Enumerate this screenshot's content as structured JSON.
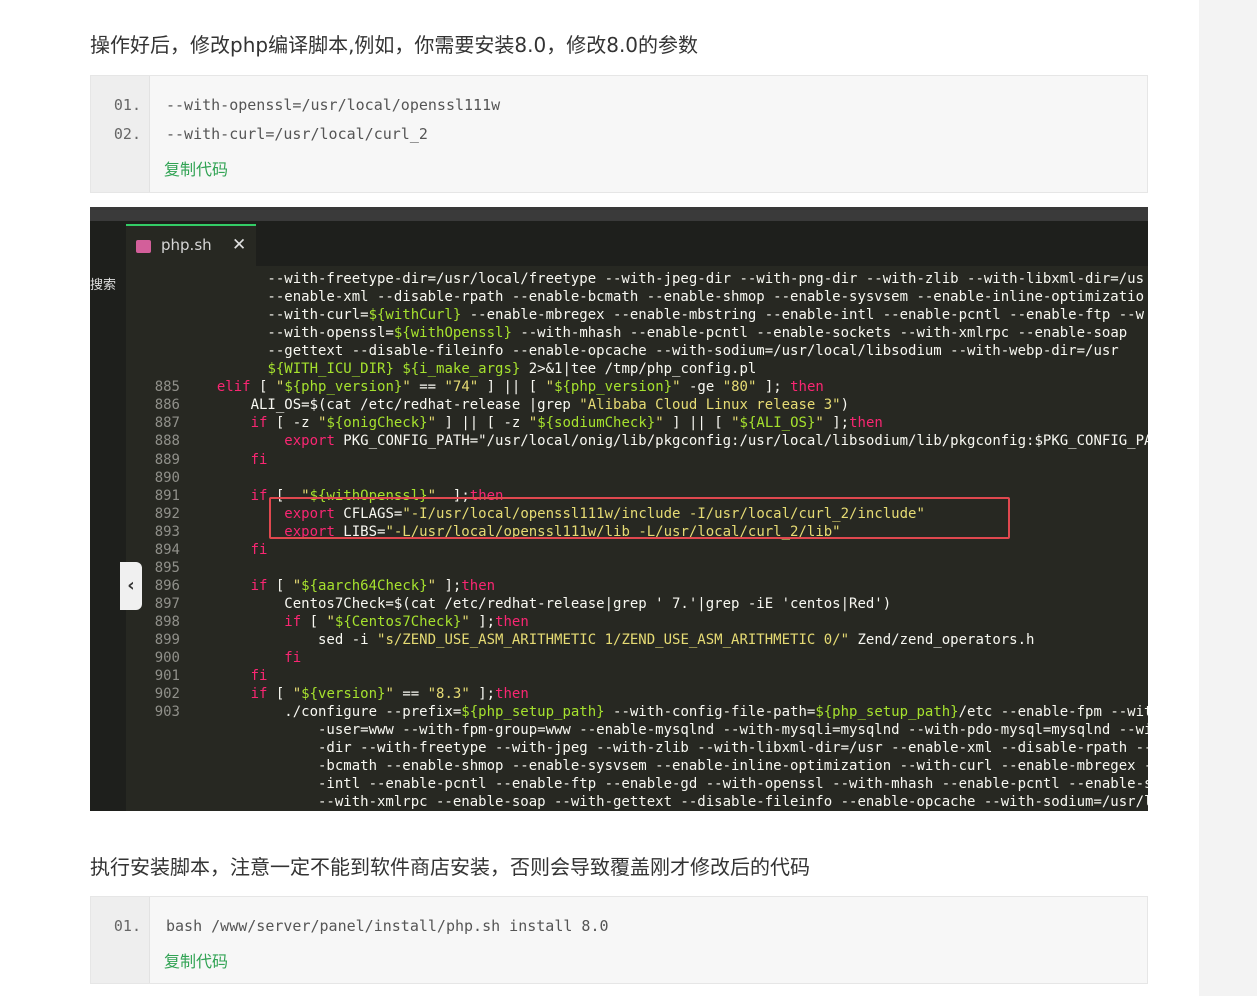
{
  "para1": "操作好后，修改php编译脚本,例如，你需要安装8.0，修改8.0的参数",
  "code1": {
    "lines": [
      {
        "num": "01.",
        "text": "--with-openssl=/usr/local/openssl111w"
      },
      {
        "num": "02.",
        "text": "--with-curl=/usr/local/curl_2"
      }
    ],
    "copy_label": "复制代码"
  },
  "editor": {
    "tab_label": "php.sh",
    "tab_close": "✕",
    "search_label": "搜索",
    "collapse_glyph": "‹",
    "lines": [
      {
        "num": "",
        "text": "        --with-freetype-dir=/usr/local/freetype --with-jpeg-dir --with-png-dir --with-zlib --with-libxml-dir=/us"
      },
      {
        "num": "",
        "text": "        --enable-xml --disable-rpath --enable-bcmath --enable-shmop --enable-sysvsem --enable-inline-optimizatio"
      },
      {
        "num": "",
        "text": "        --with-curl=${withCurl} --enable-mbregex --enable-mbstring --enable-intl --enable-pcntl --enable-ftp --w"
      },
      {
        "num": "",
        "text": "        --with-openssl=${withOpenssl} --with-mhash --enable-pcntl --enable-sockets --with-xmlrpc --enable-soap "
      },
      {
        "num": "",
        "text": "        --gettext --disable-fileinfo --enable-opcache --with-sodium=/usr/local/libsodium --with-webp-dir=/usr"
      },
      {
        "num": "",
        "text": "        ${WITH_ICU_DIR} ${i_make_args} 2>&1|tee /tmp/php_config.pl"
      },
      {
        "num": "885",
        "text": "  elif [ \"${php_version}\" == \"74\" ] || [ \"${php_version}\" -ge \"80\" ]; then"
      },
      {
        "num": "886",
        "text": "      ALI_OS=$(cat /etc/redhat-release |grep \"Alibaba Cloud Linux release 3\")"
      },
      {
        "num": "887",
        "text": "      if [ -z \"${onigCheck}\" ] || [ -z \"${sodiumCheck}\" ] || [ \"${ALI_OS}\" ];then"
      },
      {
        "num": "888",
        "text": "          export PKG_CONFIG_PATH=\"/usr/local/onig/lib/pkgconfig:/usr/local/libsodium/lib/pkgconfig:$PKG_CONFIG_PAT"
      },
      {
        "num": "889",
        "text": "      fi"
      },
      {
        "num": "890",
        "text": ""
      },
      {
        "num": "891",
        "text": "      if [  \"${withOpenssl}\"  ];then"
      },
      {
        "num": "892",
        "text": "          export CFLAGS=\"-I/usr/local/openssl111w/include -I/usr/local/curl_2/include\""
      },
      {
        "num": "893",
        "text": "          export LIBS=\"-L/usr/local/openssl111w/lib -L/usr/local/curl_2/lib\""
      },
      {
        "num": "894",
        "text": "      fi"
      },
      {
        "num": "895",
        "text": ""
      },
      {
        "num": "896",
        "text": "      if [ \"${aarch64Check}\" ];then"
      },
      {
        "num": "897",
        "text": "          Centos7Check=$(cat /etc/redhat-release|grep ' 7.'|grep -iE 'centos|Red')"
      },
      {
        "num": "898",
        "text": "          if [ \"${Centos7Check}\" ];then"
      },
      {
        "num": "899",
        "text": "              sed -i \"s/ZEND_USE_ASM_ARITHMETIC 1/ZEND_USE_ASM_ARITHMETIC 0/\" Zend/zend_operators.h"
      },
      {
        "num": "900",
        "text": "          fi"
      },
      {
        "num": "901",
        "text": "      fi"
      },
      {
        "num": "902",
        "text": "      if [ \"${version}\" == \"8.3\" ];then"
      },
      {
        "num": "903",
        "text": "          ./configure --prefix=${php_setup_path} --with-config-file-path=${php_setup_path}/etc --enable-fpm --with"
      },
      {
        "num": "",
        "text": "              -user=www --with-fpm-group=www --enable-mysqlnd --with-mysqli=mysqlnd --with-pdo-mysql=mysqlnd --wit"
      },
      {
        "num": "",
        "text": "              -dir --with-freetype --with-jpeg --with-zlib --with-libxml-dir=/usr --enable-xml --disable-rpath --e"
      },
      {
        "num": "",
        "text": "              -bcmath --enable-shmop --enable-sysvsem --enable-inline-optimization --with-curl --enable-mbregex --"
      },
      {
        "num": "",
        "text": "              -intl --enable-pcntl --enable-ftp --enable-gd --with-openssl --with-mhash --enable-pcntl --enable-so"
      },
      {
        "num": "",
        "text": "              --with-xmlrpc --enable-soap --with-gettext --disable-fileinfo --enable-opcache --with-sodium=/usr/l"
      }
    ]
  },
  "para2": "执行安装脚本，注意一定不能到软件商店安装，否则会导致覆盖刚才修改后的代码",
  "code2": {
    "lines": [
      {
        "num": "01.",
        "text": "bash /www/server/panel/install/php.sh install 8.0"
      }
    ],
    "copy_label": "复制代码"
  }
}
